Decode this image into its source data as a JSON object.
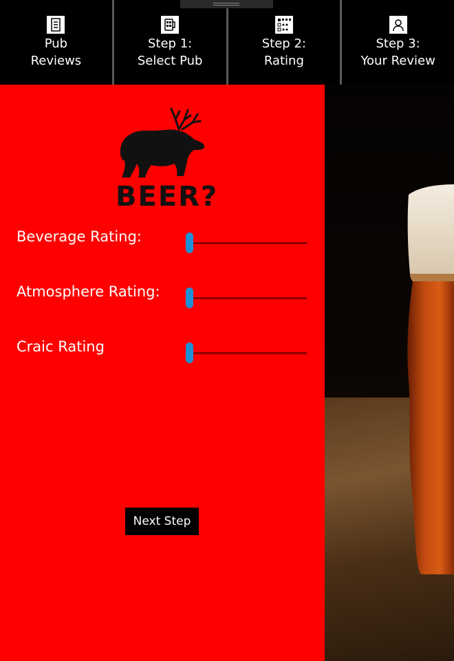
{
  "nav": {
    "items": [
      {
        "line1": "Pub",
        "line2": "Reviews",
        "icon": "document-list-icon"
      },
      {
        "line1": "Step 1:",
        "line2": "Select Pub",
        "icon": "pub-menu-icon"
      },
      {
        "line1": "Step 2:",
        "line2": "Rating",
        "icon": "rating-grid-icon"
      },
      {
        "line1": "Step 3:",
        "line2": "Your Review",
        "icon": "user-icon"
      }
    ]
  },
  "logo": {
    "text": "BEER?"
  },
  "ratings": [
    {
      "label": "Beverage Rating:",
      "value": 0
    },
    {
      "label": "Atmosphere Rating:",
      "value": 0
    },
    {
      "label": "Craic Rating",
      "value": 0
    }
  ],
  "next_button": {
    "label": "Next Step"
  },
  "colors": {
    "panel": "#ff0000",
    "slider_thumb": "#1e90d6",
    "nav_bg": "#000000"
  }
}
